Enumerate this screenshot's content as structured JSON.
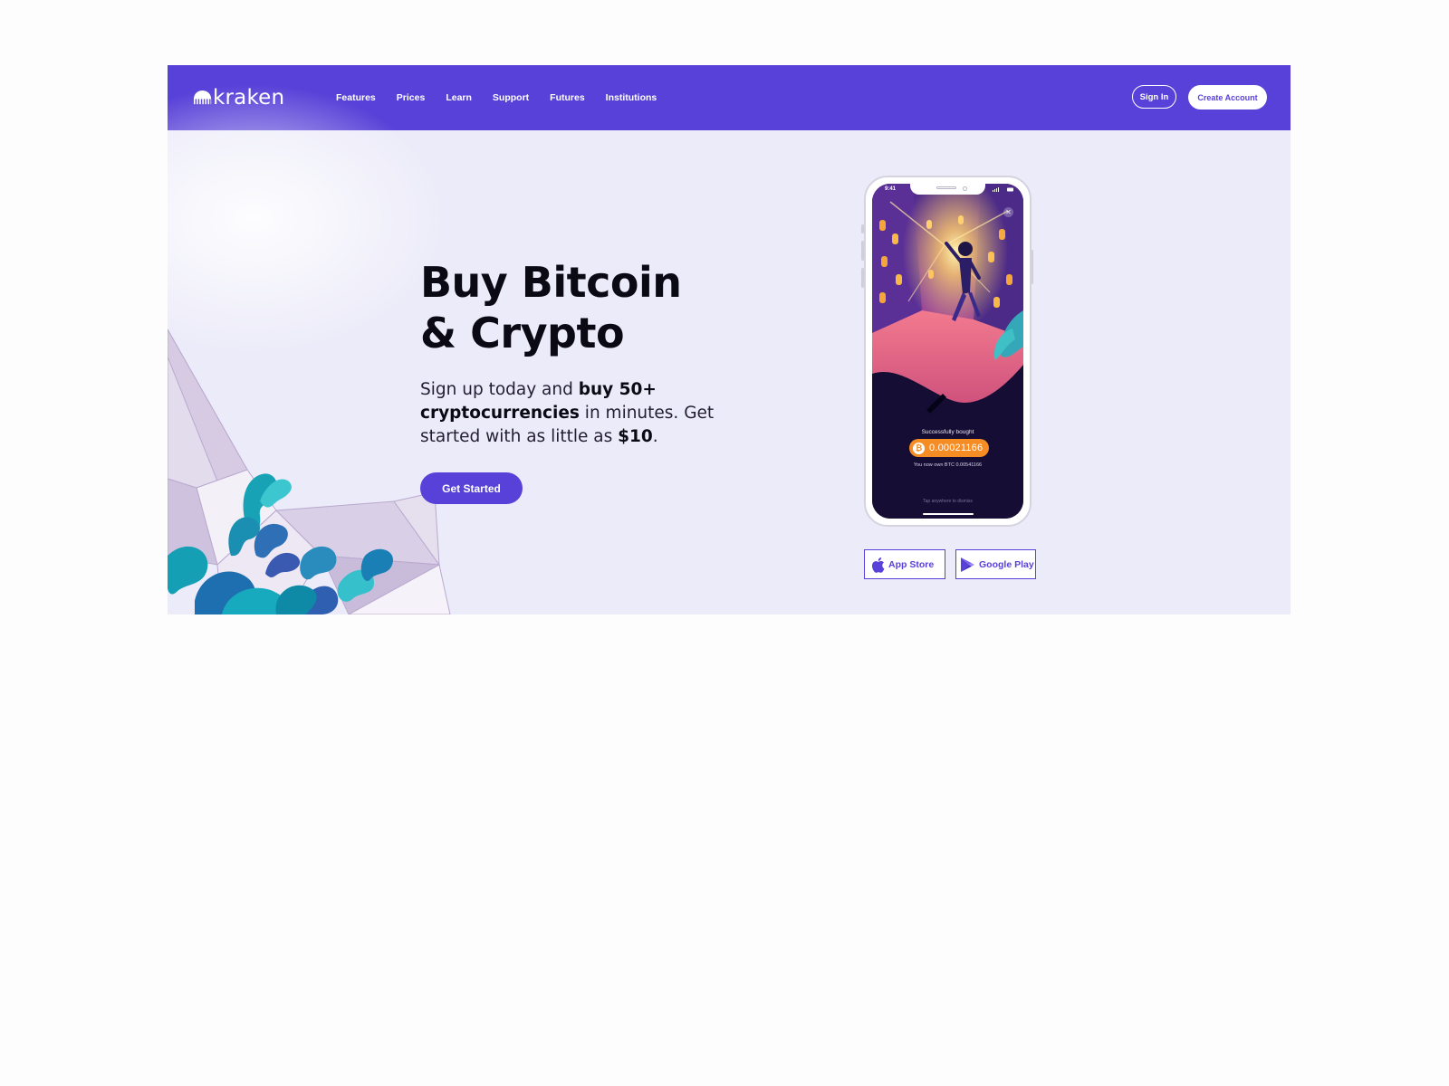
{
  "header": {
    "logo_text": "kraken",
    "nav": [
      "Features",
      "Prices",
      "Learn",
      "Support",
      "Futures",
      "Institutions"
    ],
    "sign_in": "Sign In",
    "create_account": "Create Account"
  },
  "hero": {
    "title_line1": "Buy Bitcoin",
    "title_line2": "& Crypto",
    "subtitle": {
      "part1": "Sign up today and ",
      "bold1": "buy 50+ cryptocurrencies",
      "part2": " in minutes. Get started with as little as ",
      "bold2": "$10",
      "part3": "."
    },
    "cta": "Get Started"
  },
  "phone": {
    "status_time": "9:41",
    "close_glyph": "✕",
    "bought_label": "Successfully bought",
    "btc_symbol": "₿",
    "btc_amount": "0.00021166",
    "own_label": "You now own BTC 0.00541166",
    "tap_label": "Tap anywhere to dismiss"
  },
  "stores": {
    "apple": "App Store",
    "google": "Google Play"
  },
  "colors": {
    "brand": "#5841d8",
    "hero_bg": "#ecebf9",
    "btc_orange": "#f68c24",
    "text_dark": "#0b0a14"
  },
  "icons": {
    "logo": "kraken-logo-icon",
    "apple": "apple-icon",
    "google": "google-play-icon",
    "btc": "bitcoin-icon",
    "close": "close-icon"
  }
}
